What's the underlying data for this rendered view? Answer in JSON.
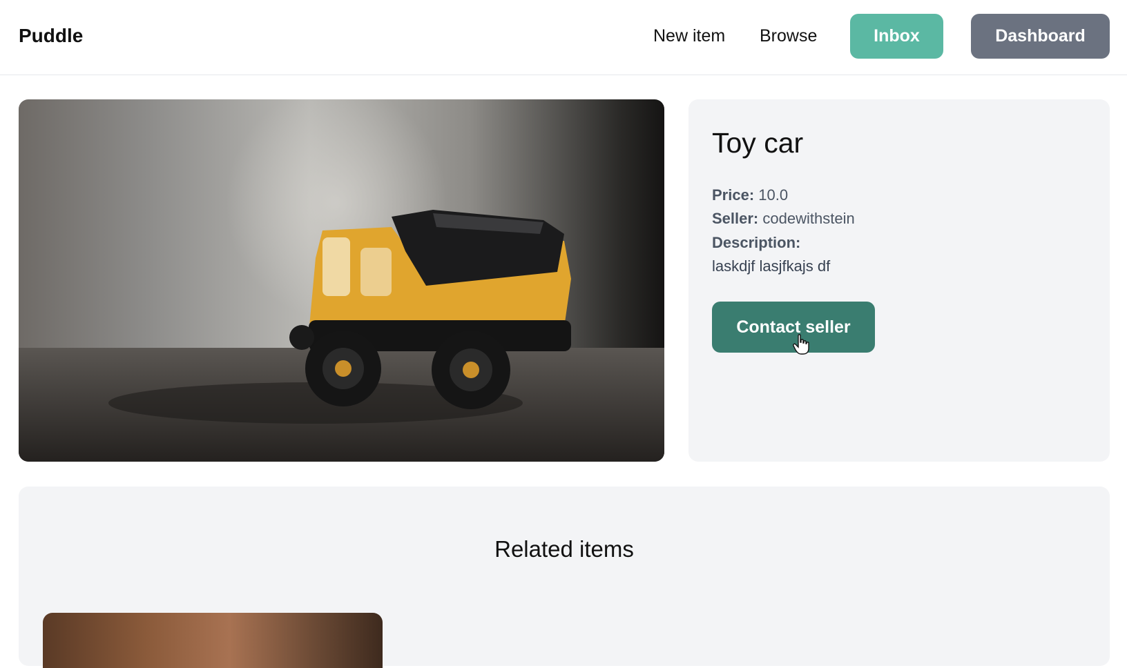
{
  "colors": {
    "inbox_bg": "#5bb8a3",
    "dashboard_bg": "#6b7280",
    "contact_bg": "#3a7d70",
    "card_bg": "#f3f4f6"
  },
  "navbar": {
    "brand": "Puddle",
    "links": {
      "new_item": "New item",
      "browse": "Browse"
    },
    "inbox_label": "Inbox",
    "dashboard_label": "Dashboard"
  },
  "item": {
    "image_icon": "toy-truck-photo",
    "title": "Toy car",
    "price_label": "Price:",
    "price_value": "10.0",
    "seller_label": "Seller:",
    "seller_value": "codewithstein",
    "description_label": "Description:",
    "description_value": "laskdjf lasjfkajs df",
    "contact_label": "Contact seller"
  },
  "related": {
    "title": "Related items"
  }
}
